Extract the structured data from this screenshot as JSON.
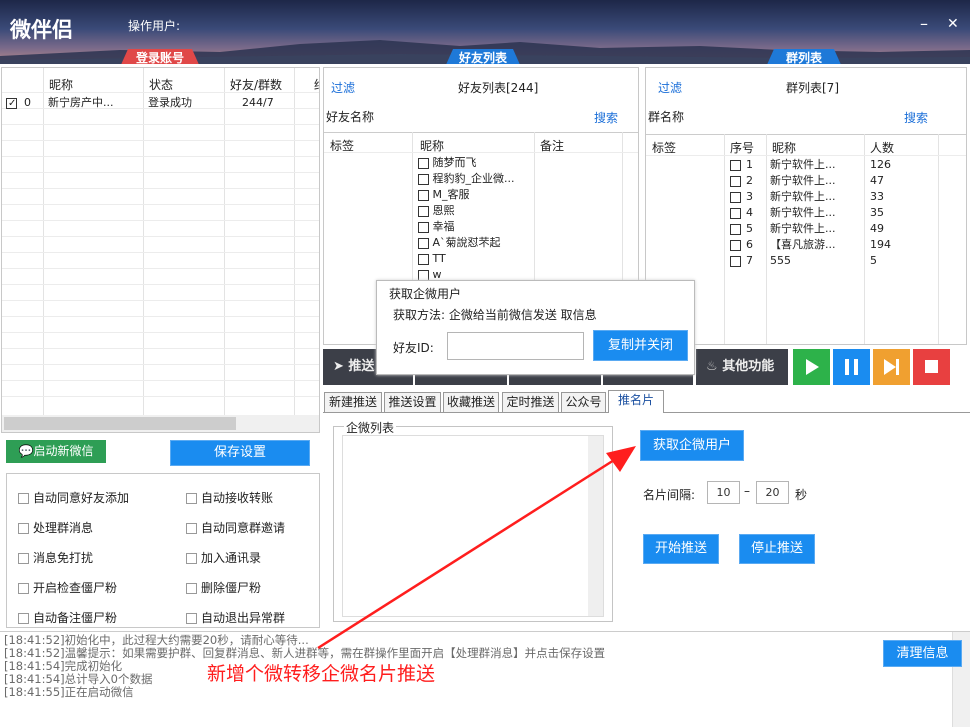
{
  "app": {
    "title": "微伴侣",
    "operator_label": "操作用户:",
    "minimize": "–",
    "close": "✕"
  },
  "section_tabs": {
    "login": "登录账号",
    "friends": "好友列表",
    "groups": "群列表"
  },
  "login_table": {
    "headers": [
      "昵称",
      "状态",
      "好友/群数",
      "终"
    ],
    "rows": [
      {
        "index": "0",
        "nickname": "新宁房产中...",
        "status": "登录成功",
        "count": "244/7"
      }
    ]
  },
  "buttons": {
    "start_wechat": "启动新微信",
    "save_settings": "保存设置",
    "clear_info": "清理信息",
    "get_wecom_user": "获取企微用户",
    "start_push": "开始推送",
    "stop_push": "停止推送",
    "copy_close": "复制并关闭"
  },
  "options": [
    [
      "自动同意好友添加",
      "自动接收转账"
    ],
    [
      "处理群消息",
      "自动同意群邀请"
    ],
    [
      "消息免打扰",
      "加入通讯录"
    ],
    [
      "开启检查僵尸粉",
      "删除僵尸粉"
    ],
    [
      "自动备注僵尸粉",
      "自动退出异常群"
    ]
  ],
  "friends_panel": {
    "filter": "过滤",
    "title": "好友列表[244]",
    "name_label": "好友名称",
    "search": "搜索",
    "headers": [
      "标签",
      "昵称",
      "备注"
    ],
    "rows": [
      "随梦而飞",
      "程豹豹_企业微...",
      "M_客服",
      "恩熙",
      "幸福",
      "A`菊說怼芣起",
      "TT",
      "w"
    ]
  },
  "groups_panel": {
    "filter": "过滤",
    "title": "群列表[7]",
    "name_label": "群名称",
    "search": "搜索",
    "headers": [
      "标签",
      "序号",
      "昵称",
      "人数"
    ],
    "rows": [
      {
        "seq": "1",
        "name": "新宁软件上...",
        "count": "126"
      },
      {
        "seq": "2",
        "name": "新宁软件上...",
        "count": "47"
      },
      {
        "seq": "3",
        "name": "新宁软件上...",
        "count": "33"
      },
      {
        "seq": "4",
        "name": "新宁软件上...",
        "count": "35"
      },
      {
        "seq": "5",
        "name": "新宁软件上...",
        "count": "49"
      },
      {
        "seq": "6",
        "name": "【喜凡旅游...",
        "count": "194"
      },
      {
        "seq": "7",
        "name": "555",
        "count": "5"
      }
    ]
  },
  "popup": {
    "title": "获取企微用户",
    "method": "获取方法: 企微给当前微信发送 取信息",
    "id_label": "好友ID:",
    "id_value": ""
  },
  "toolbar": {
    "push": "推送",
    "other": "其他功能"
  },
  "sub_tabs": [
    "新建推送",
    "推送设置",
    "收藏推送",
    "定时推送",
    "公众号",
    "推名片"
  ],
  "card_push": {
    "list_title": "企微列表",
    "interval_label": "名片间隔:",
    "interval_min": "10",
    "interval_dash": "–",
    "interval_max": "20",
    "interval_unit": "秒"
  },
  "logs": [
    "[18:41:52]初始化中，此过程大约需要20秒，请耐心等待...",
    "[18:41:52]温馨提示：如果需要护群、回复群消息、新人进群等，需在群操作里面开启【处理群消息】并点击保存设置",
    "[18:41:54]完成初始化",
    "[18:41:54]总计导入0个数据",
    "[18:41:55]正在启动微信"
  ],
  "annotation": "新增个微转移企微名片推送",
  "colors": {
    "accent": "#1a8cf0",
    "login_tab": "#e04848",
    "annotation": "#ff1e1e",
    "play": "#2db24a",
    "pause": "#1a8cf0",
    "next": "#f0a030",
    "stop": "#e84040"
  }
}
